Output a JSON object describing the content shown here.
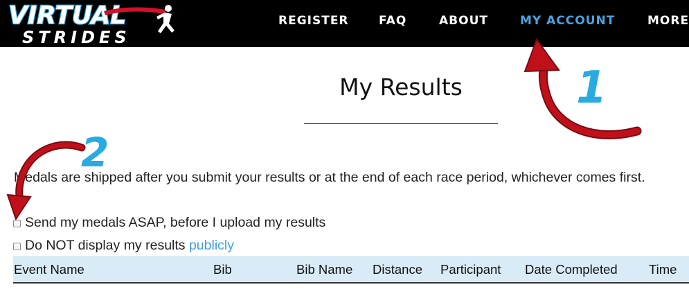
{
  "brand": {
    "logo_line1": "VIRTUAL",
    "logo_line2": "STRIDES"
  },
  "nav": {
    "items": [
      {
        "label": "REGISTER"
      },
      {
        "label": "FAQ"
      },
      {
        "label": "ABOUT"
      },
      {
        "label": "MY ACCOUNT",
        "active": true
      },
      {
        "label": "MORE"
      }
    ]
  },
  "page": {
    "title": "My Results",
    "notice": "Medals are shipped after you submit your results or at the end of each race period, whichever comes first."
  },
  "options": {
    "send_asap": {
      "label": "Send my medals ASAP, before I upload my results",
      "checked": false
    },
    "hide_results": {
      "label_prefix": "Do NOT display my results ",
      "link_text": "publicly",
      "checked": false
    }
  },
  "table": {
    "columns": [
      "Event Name",
      "Bib",
      "Bib Name",
      "Distance",
      "Participant",
      "Date Completed",
      "Time"
    ]
  },
  "annotations": {
    "marker_1": "1",
    "marker_2": "2"
  },
  "colors": {
    "accent": "#4aa3df",
    "header_bg": "#000000",
    "table_header_bg": "#d9ebf6",
    "arrow": "#c0111b",
    "marker": "#29abe2"
  }
}
